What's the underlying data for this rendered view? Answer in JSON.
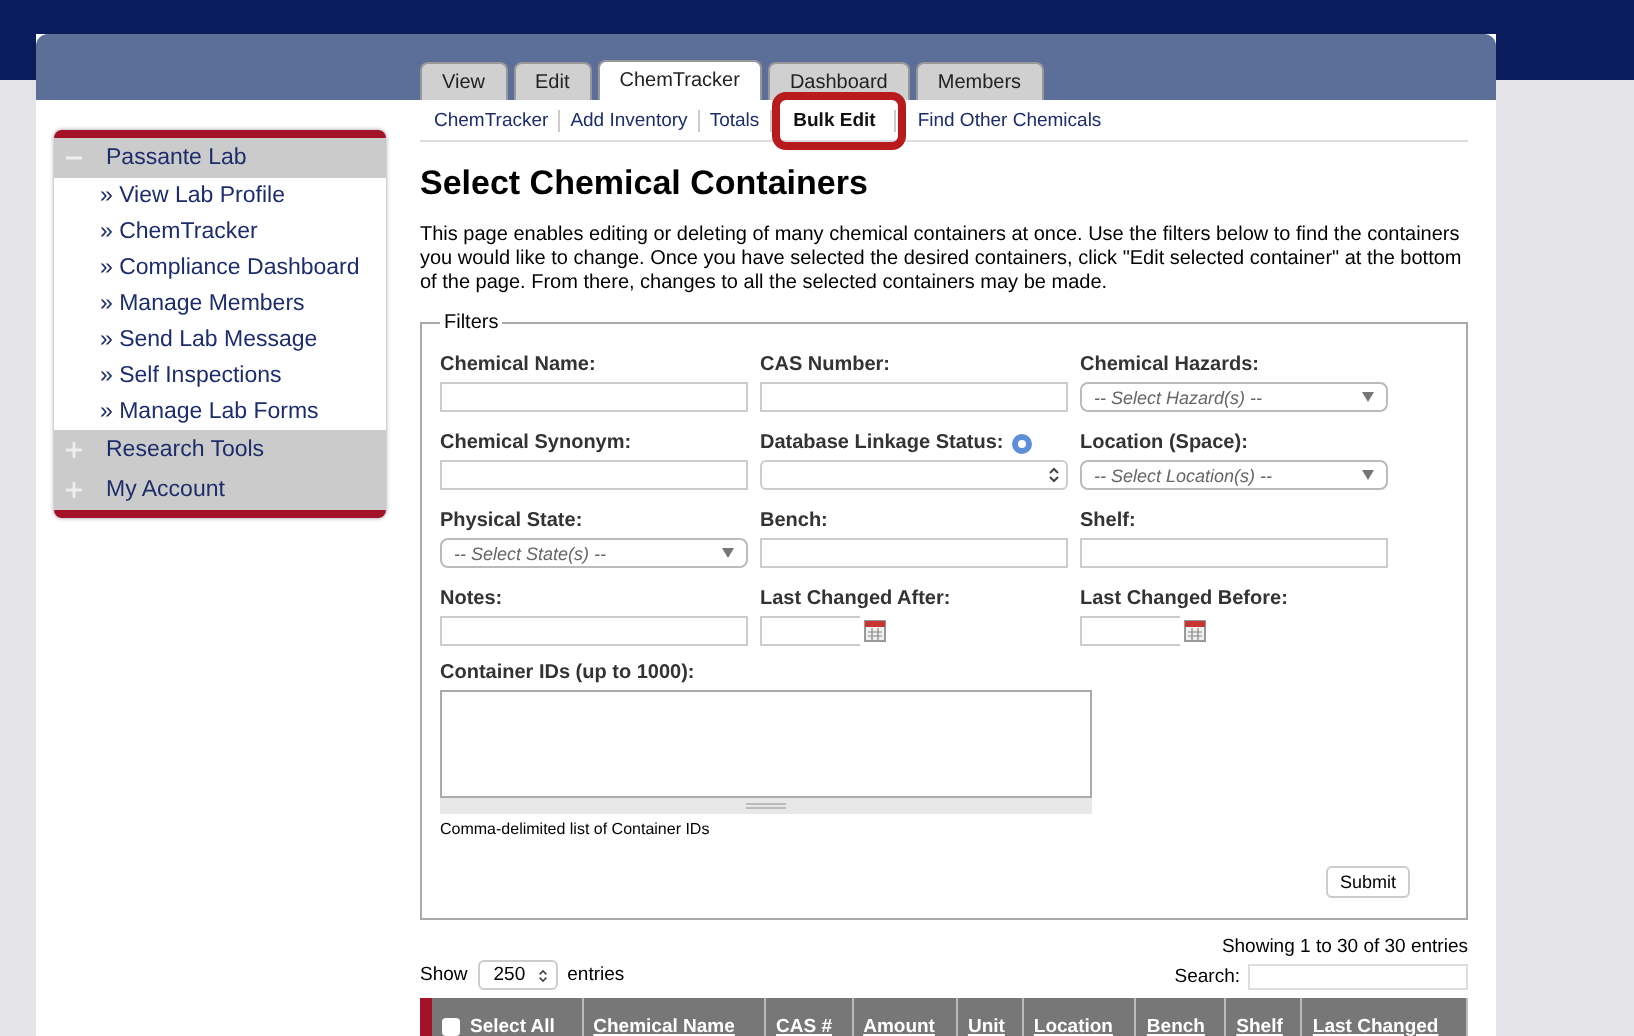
{
  "tabs": [
    {
      "label": "View",
      "selected": false
    },
    {
      "label": "Edit",
      "selected": false
    },
    {
      "label": "ChemTracker",
      "selected": true
    },
    {
      "label": "Dashboard",
      "selected": false
    },
    {
      "label": "Members",
      "selected": false
    }
  ],
  "subnav": [
    {
      "label": "ChemTracker",
      "selected": false
    },
    {
      "label": "Add Inventory",
      "selected": false
    },
    {
      "label": "Totals",
      "selected": false
    },
    {
      "label": "Bulk Edit",
      "selected": true
    },
    {
      "label": "Find Other Chemicals",
      "selected": false
    }
  ],
  "sidebar": {
    "sections": [
      {
        "label": "Passante Lab",
        "expanded": true,
        "children": [
          {
            "label": "» View Lab Profile"
          },
          {
            "label": "» ChemTracker"
          },
          {
            "label": "» Compliance Dashboard"
          },
          {
            "label": "» Manage Members"
          },
          {
            "label": "» Send Lab Message"
          },
          {
            "label": "» Self Inspections"
          },
          {
            "label": "» Manage Lab Forms"
          }
        ]
      },
      {
        "label": "Research Tools",
        "expanded": false
      },
      {
        "label": "My Account",
        "expanded": false
      }
    ]
  },
  "page": {
    "title": "Select Chemical Containers",
    "intro": "This page enables editing or deleting of many chemical containers at once. Use the filters below to find the containers you would like to change. Once you have selected the desired containers, click \"Edit selected container\" at the bottom of the page. From there, changes to all the selected containers may be made."
  },
  "filters": {
    "legend": "Filters",
    "fields": [
      {
        "label": "Chemical Name:",
        "kind": "text"
      },
      {
        "label": "CAS Number:",
        "kind": "text"
      },
      {
        "label": "Chemical Hazards:",
        "kind": "select",
        "placeholder": "-- Select Hazard(s) --"
      },
      {
        "label": "Chemical Synonym:",
        "kind": "text"
      },
      {
        "label": "Database Linkage Status:",
        "kind": "stepper",
        "help": true
      },
      {
        "label": "Location (Space):",
        "kind": "select",
        "placeholder": "-- Select Location(s) --"
      },
      {
        "label": "Physical State:",
        "kind": "select",
        "placeholder": "-- Select State(s) --"
      },
      {
        "label": "Bench:",
        "kind": "text"
      },
      {
        "label": "Shelf:",
        "kind": "text"
      },
      {
        "label": "Notes:",
        "kind": "text"
      },
      {
        "label": "Last Changed After:",
        "kind": "date"
      },
      {
        "label": "Last Changed Before:",
        "kind": "date"
      }
    ],
    "ids_label": "Container IDs (up to 1000):",
    "ids_hint": "Comma-delimited list of Container IDs",
    "submit": "Submit"
  },
  "table": {
    "show_label": "Show",
    "page_size": "250",
    "entries_label": "entries",
    "info": "Showing 1 to 30 of 30 entries",
    "search_label": "Search:",
    "columns": [
      "Select All",
      "Chemical Name",
      "CAS #",
      "Amount",
      "Unit",
      "Location",
      "Bench",
      "Shelf",
      "Last Changed"
    ]
  }
}
